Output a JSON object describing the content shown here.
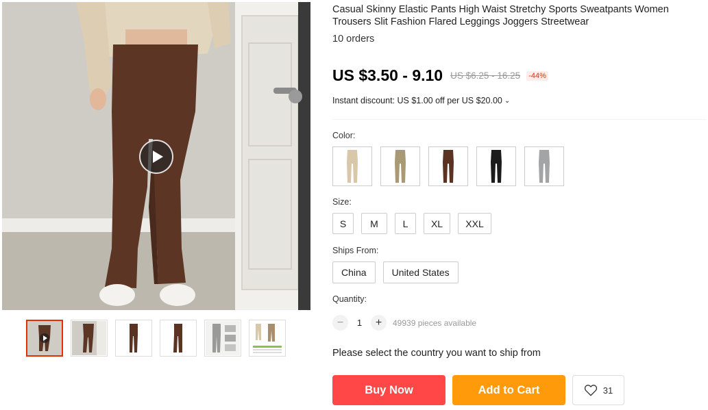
{
  "product": {
    "title": "Casual Skinny Elastic Pants High Waist Stretchy Sports Sweatpants Women Trousers Slit Fashion Flared Leggings Joggers Streetwear",
    "orders": "10 orders",
    "price": "US $3.50 - 9.10",
    "original_price": "US $6.25 - 16.25",
    "discount": "-44%",
    "instant_discount": "Instant discount: US $1.00 off per US $20.00",
    "instant_chevron": "chevron-down-icon"
  },
  "gallery": {
    "main_image": "brown-flared-pants-photo",
    "play_icon": "play-icon",
    "thumbnails": [
      {
        "name": "brown-pants-video-thumb",
        "color": "#6b3d2a",
        "active": true
      },
      {
        "name": "brown-pants-photo-thumb",
        "color": "#6b3d2a"
      },
      {
        "name": "brown-pants-flat-thumb",
        "color": "#5a3322"
      },
      {
        "name": "brown-pants-flat-thumb-2",
        "color": "#5a3322"
      },
      {
        "name": "gray-pants-collage-thumb",
        "color": "#9a9a98"
      },
      {
        "name": "size-chart-thumb",
        "color": "#b49a7a"
      }
    ]
  },
  "options": {
    "color_label": "Color:",
    "colors": [
      {
        "name": "beige",
        "hex": "#d8c7a8"
      },
      {
        "name": "khaki",
        "hex": "#a89a74"
      },
      {
        "name": "brown",
        "hex": "#5a3322"
      },
      {
        "name": "black",
        "hex": "#1c1c1c"
      },
      {
        "name": "gray",
        "hex": "#a3a4a6"
      }
    ],
    "size_label": "Size:",
    "sizes": [
      "S",
      "M",
      "L",
      "XL",
      "XXL"
    ],
    "ships_label": "Ships From:",
    "ships_from": [
      "China",
      "United States"
    ],
    "quantity_label": "Quantity:",
    "quantity": "1",
    "minus": "−",
    "plus": "+",
    "available": "49939 pieces available"
  },
  "ship_note": "Please select the country you want to ship from",
  "actions": {
    "buy_now": "Buy Now",
    "add_to_cart": "Add to Cart",
    "wishlist_count": "31",
    "wishlist_icon": "heart-icon"
  },
  "colors": {
    "buy": "#ff4747",
    "cart": "#ff9a0a",
    "accent": "#e62e04"
  }
}
